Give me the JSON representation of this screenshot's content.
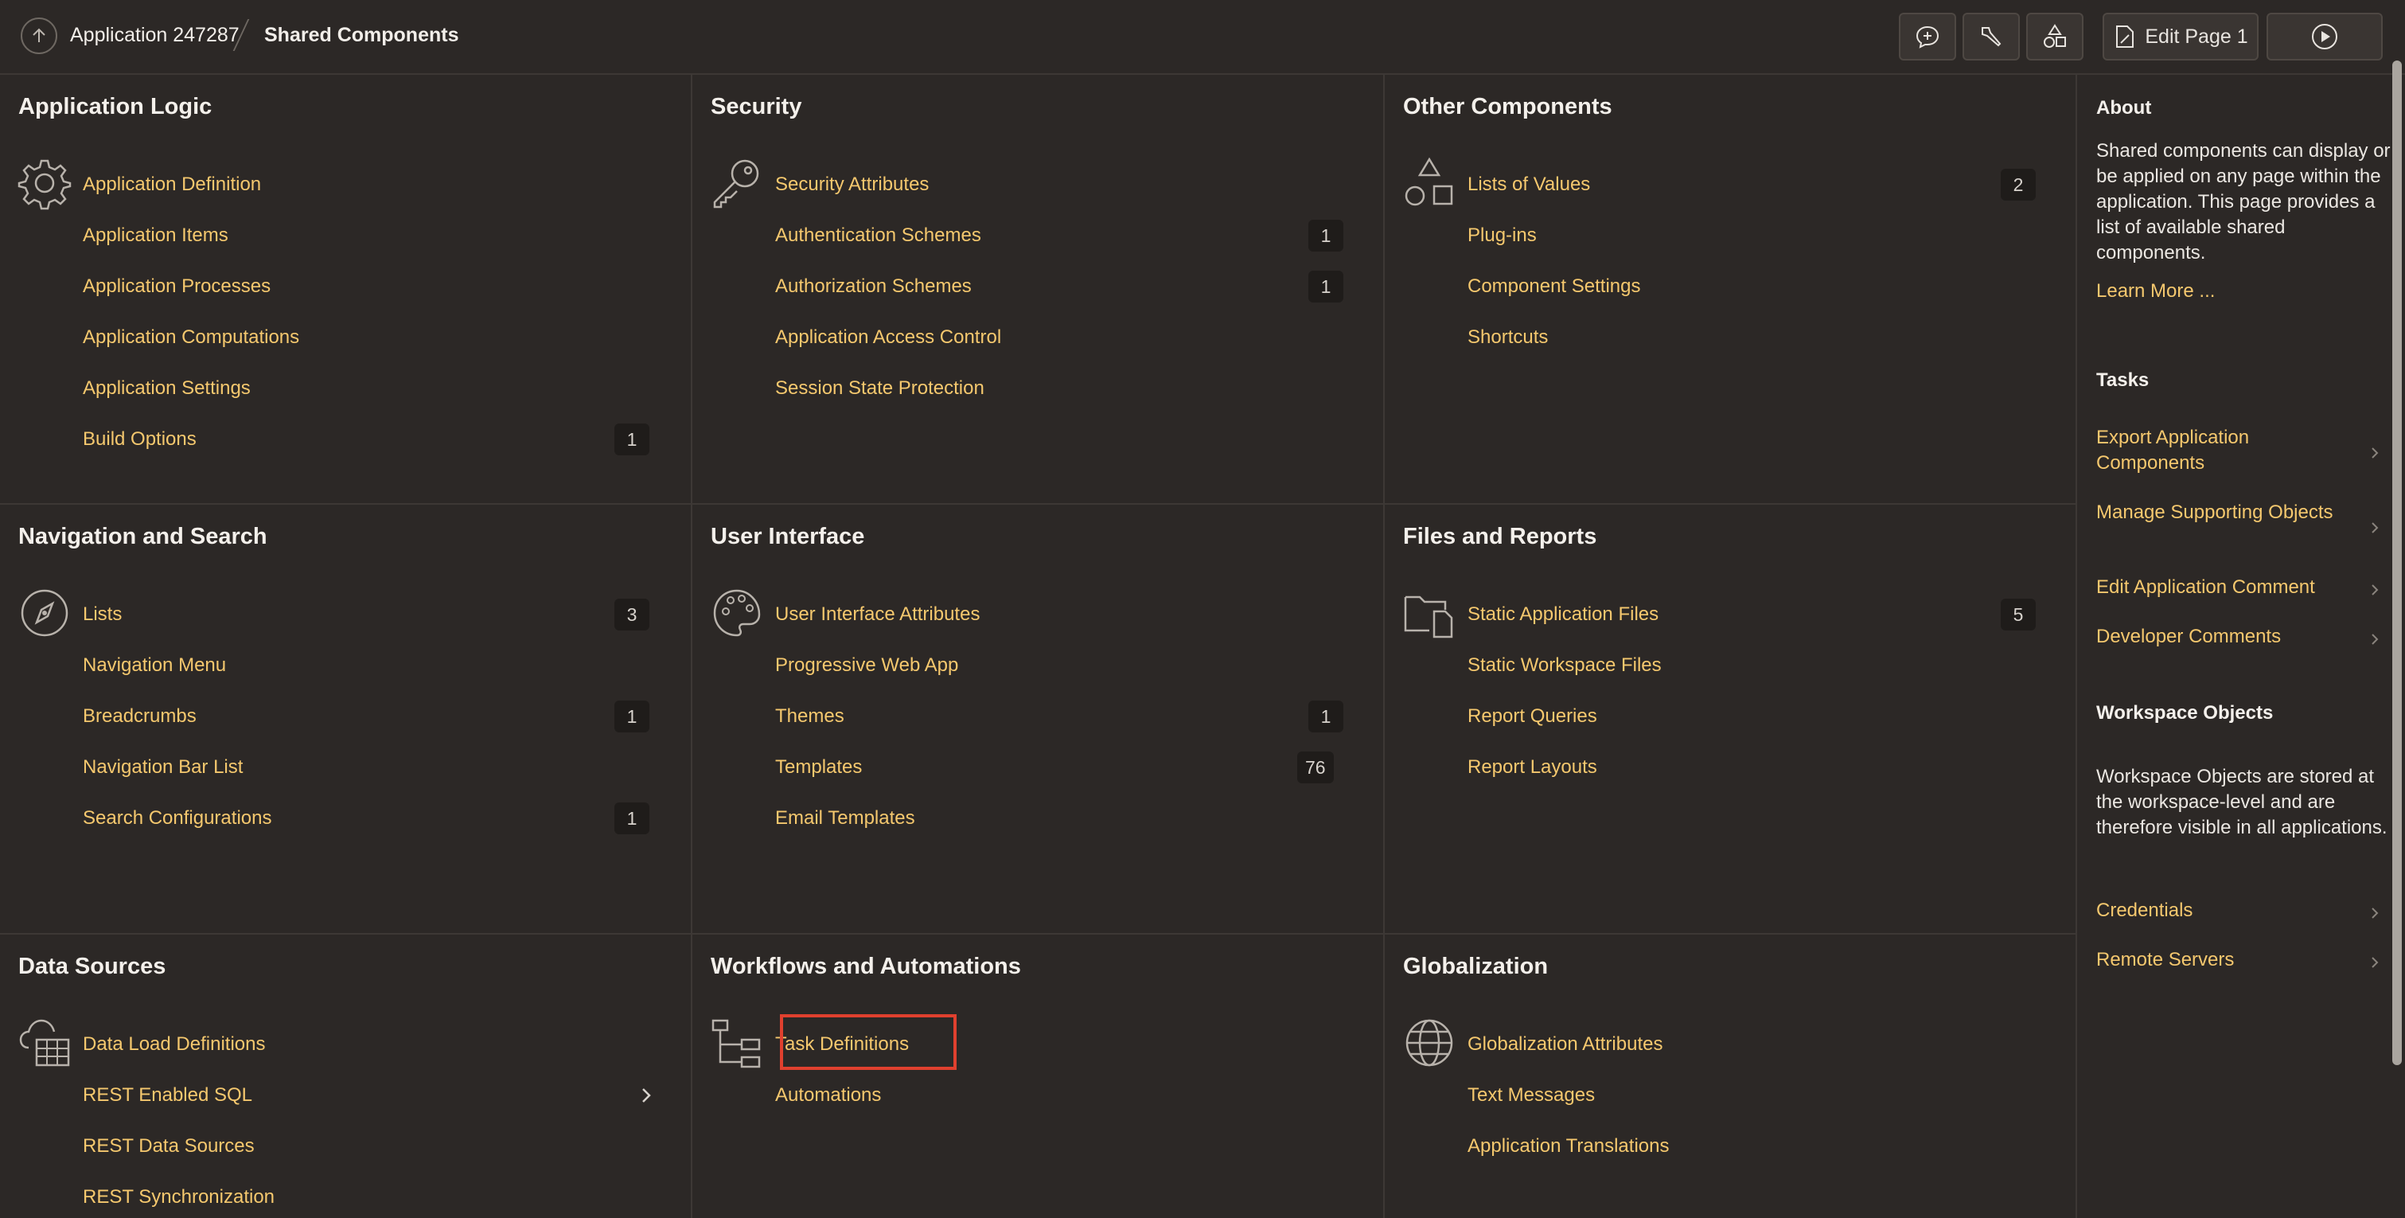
{
  "breadcrumb": {
    "app": "Application 247287",
    "current": "Shared Components"
  },
  "toolbar": {
    "edit_page_label": "Edit Page 1"
  },
  "sections": {
    "application_logic": {
      "title": "Application Logic",
      "items": [
        "Application Definition",
        "Application Items",
        "Application Processes",
        "Application Computations",
        "Application Settings",
        "Build Options"
      ],
      "badges": {
        "build_options": "1"
      }
    },
    "security": {
      "title": "Security",
      "items": [
        "Security Attributes",
        "Authentication Schemes",
        "Authorization Schemes",
        "Application Access Control",
        "Session State Protection"
      ],
      "badges": {
        "authentication_schemes": "1",
        "authorization_schemes": "1"
      }
    },
    "other_components": {
      "title": "Other Components",
      "items": [
        "Lists of Values",
        "Plug-ins",
        "Component Settings",
        "Shortcuts"
      ],
      "badges": {
        "lists_of_values": "2"
      }
    },
    "navigation_search": {
      "title": "Navigation and Search",
      "items": [
        "Lists",
        "Navigation Menu",
        "Breadcrumbs",
        "Navigation Bar List",
        "Search Configurations"
      ],
      "badges": {
        "lists": "3",
        "breadcrumbs": "1",
        "search_configurations": "1"
      }
    },
    "user_interface": {
      "title": "User Interface",
      "items": [
        "User Interface Attributes",
        "Progressive Web App",
        "Themes",
        "Templates",
        "Email Templates"
      ],
      "badges": {
        "themes": "1",
        "templates": "76"
      }
    },
    "files_reports": {
      "title": "Files and Reports",
      "items": [
        "Static Application Files",
        "Static Workspace Files",
        "Report Queries",
        "Report Layouts"
      ],
      "badges": {
        "static_application_files": "5"
      }
    },
    "data_sources": {
      "title": "Data Sources",
      "items": [
        "Data Load Definitions",
        "REST Enabled SQL",
        "REST Data Sources",
        "REST Synchronization"
      ]
    },
    "workflows": {
      "title": "Workflows and Automations",
      "items": [
        "Task Definitions",
        "Automations"
      ]
    },
    "globalization": {
      "title": "Globalization",
      "items": [
        "Globalization Attributes",
        "Text Messages",
        "Application Translations"
      ]
    }
  },
  "sidebar": {
    "about_title": "About",
    "about_text": "Shared components can display or be applied on any page within the application. This page provides a list of available shared components.",
    "learn_more": "Learn More ...",
    "tasks_title": "Tasks",
    "tasks": [
      "Export Application Components",
      "Manage Supporting Objects",
      "Edit Application Comment",
      "Developer Comments"
    ],
    "workspace_title": "Workspace Objects",
    "workspace_text": "Workspace Objects are stored at the workspace-level and are therefore visible in all applications.",
    "workspace_links": [
      "Credentials",
      "Remote Servers"
    ]
  },
  "colors": {
    "link": "#f5c86e",
    "background": "#2c2826",
    "highlight": "#e0402e"
  }
}
